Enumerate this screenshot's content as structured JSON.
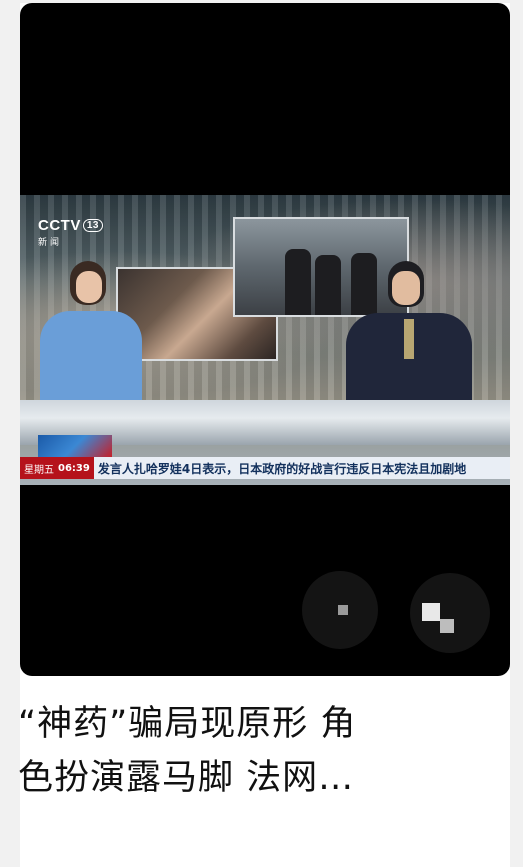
{
  "video": {
    "channel_logo": "CCTV",
    "channel_number": "13",
    "channel_name": "新闻",
    "ticker_day": "星期五",
    "ticker_time": "06:39",
    "ticker_text": "发言人扎哈罗娃4日表示，日本政府的好战言行违反日本宪法且加剧地"
  },
  "article": {
    "title_line1": "“神药”骗局现原形 角",
    "title_line2": "色扮演露马脚 法网…"
  }
}
